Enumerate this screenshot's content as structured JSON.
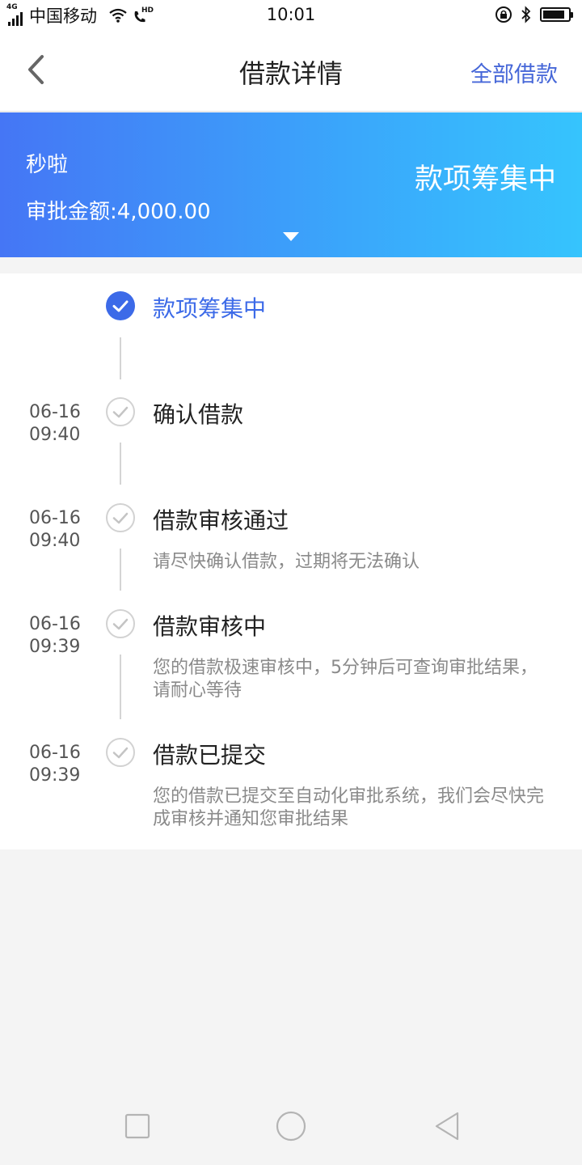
{
  "status_bar": {
    "network_type": "4G",
    "carrier": "中国移动",
    "hd_label": "HD",
    "time": "10:01"
  },
  "nav": {
    "title": "借款详情",
    "right_link": "全部借款"
  },
  "banner": {
    "name": "秒啦",
    "amount_label": "审批金额:4,000.00",
    "status": "款项筹集中"
  },
  "timeline": [
    {
      "date": "",
      "time": "",
      "title": "款项筹集中",
      "description": "",
      "active": true
    },
    {
      "date": "06-16",
      "time": "09:40",
      "title": "确认借款",
      "description": "",
      "active": false
    },
    {
      "date": "06-16",
      "time": "09:40",
      "title": "借款审核通过",
      "description": "请尽快确认借款，过期将无法确认",
      "active": false
    },
    {
      "date": "06-16",
      "time": "09:39",
      "title": "借款审核中",
      "description": "您的借款极速审核中，5分钟后可查询审批结果，请耐心等待",
      "active": false
    },
    {
      "date": "06-16",
      "time": "09:39",
      "title": "借款已提交",
      "description": "您的借款已提交至自动化审批系统，我们会尽快完成审核并通知您审批结果",
      "active": false
    }
  ],
  "colors": {
    "accent": "#3c6ae8",
    "link": "#4667d8",
    "banner_start": "#4576f5",
    "banner_end": "#36c4fd",
    "muted_text": "#8a8a8a"
  },
  "icons": {
    "back": "chevron-left-icon",
    "caret": "caret-down-icon",
    "check_active": "check-circle-filled-icon",
    "check_done": "check-circle-outline-icon",
    "sys_recent": "square-icon",
    "sys_home": "circle-icon",
    "sys_back": "triangle-back-icon"
  }
}
